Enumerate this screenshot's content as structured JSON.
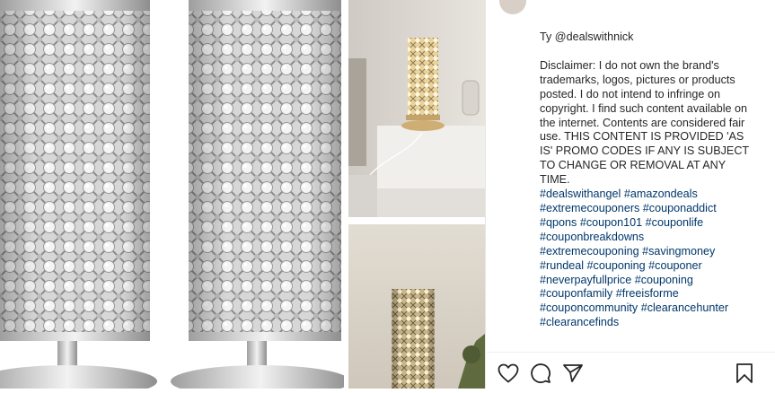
{
  "post": {
    "credit_line": "Ty @dealswithnick",
    "disclaimer": "Disclaimer: I do not own the brand's trademarks, logos, pictures or products posted. I do not intend to infringe on copyright. I find such content available on the internet. Contents are considered fair use. THIS CONTENT IS PROVIDED 'AS IS' PROMO CODES IF ANY IS SUBJECT TO CHANGE OR REMOVAL AT ANY TIME.",
    "hashtags": [
      "#dealswithangel #amazondeals",
      "#extremecouponers #couponaddict",
      "#qpons #coupon101 #couponlife",
      "#couponbreakdowns",
      "#extremecouponing #savingmoney",
      "#rundeal #couponing #couponer",
      "#neverpayfullprice #couponing",
      "#couponfamily #freeisforme",
      "#couponcommunity #clearancehunter",
      "#clearancefinds"
    ]
  },
  "actions": {
    "like": "heart-icon",
    "comment": "comment-icon",
    "share": "paper-plane-icon",
    "save": "bookmark-icon"
  },
  "colors": {
    "link": "#00376b",
    "text": "#262626",
    "muted": "#8e8e8e",
    "chrome_silver": "#c9c9c9",
    "warm_glow": "#f3d79a"
  }
}
